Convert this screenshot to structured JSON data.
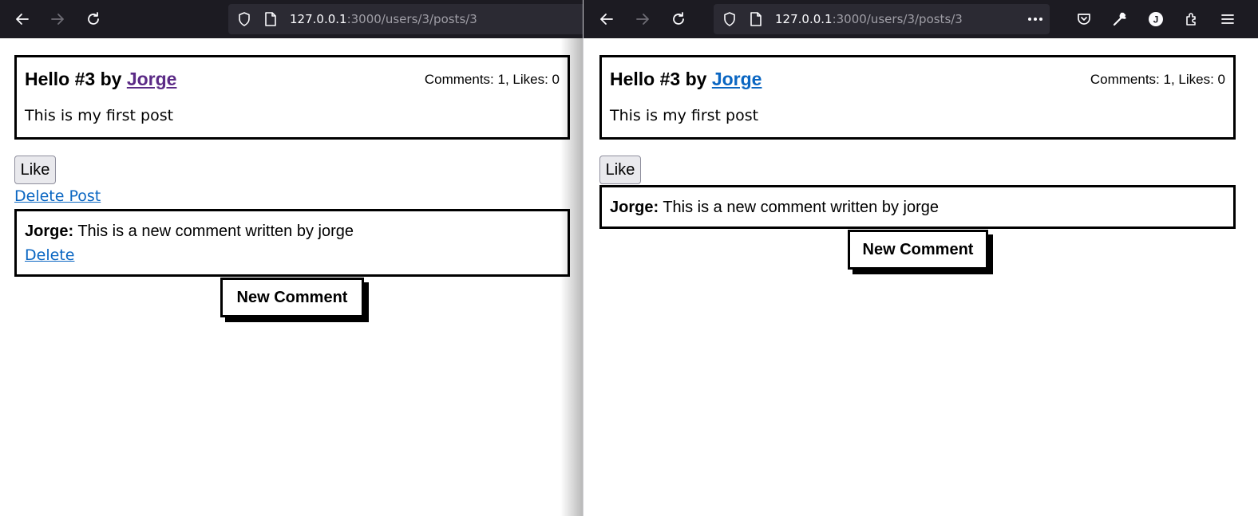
{
  "windows": [
    {
      "url_host": "127.0.0.1",
      "url_path": ":3000/users/3/posts/3",
      "post": {
        "title_prefix": "Hello #3 by ",
        "author": "Jorge",
        "stats": "Comments: 1, Likes: 0",
        "body": "This is my first post"
      },
      "like_label": "Like",
      "delete_post_label": "Delete Post",
      "comment": {
        "author": "Jorge:",
        "text": " This is a new comment written by jorge",
        "delete_label": "Delete"
      },
      "new_comment_label": "New Comment",
      "author_link_color": "#5b2a86"
    },
    {
      "url_host": "127.0.0.1",
      "url_path": ":3000/users/3/posts/3",
      "post": {
        "title_prefix": "Hello #3 by ",
        "author": "Jorge",
        "stats": "Comments: 1, Likes: 0",
        "body": "This is my first post"
      },
      "like_label": "Like",
      "comment": {
        "author": "Jorge:",
        "text": " This is a new comment written by jorge"
      },
      "new_comment_label": "New Comment",
      "author_link_color": "#0a66c2",
      "toolbar_icons": [
        "pocket-icon",
        "wrench-icon",
        "account-avatar-icon",
        "extensions-icon",
        "menu-icon"
      ],
      "avatar_letter": "J"
    }
  ],
  "colors": {
    "toolbar_bg": "#1c1b22",
    "urlbar_bg": "#2b2a33",
    "link": "#0a66c2",
    "visited_link": "#5b2a86"
  }
}
